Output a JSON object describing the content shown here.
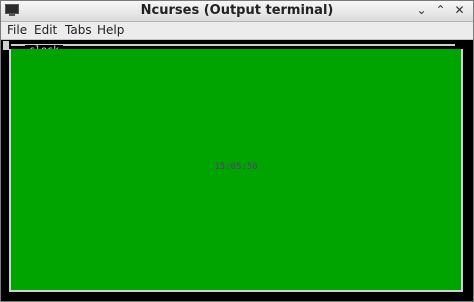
{
  "window": {
    "title": "Ncurses (Output terminal)",
    "controls": {
      "minimize": "⌄",
      "maximize": "⌃",
      "close": "✕"
    }
  },
  "menu": {
    "items": [
      "File",
      "Edit",
      "Tabs",
      "Help"
    ]
  },
  "terminal": {
    "frame_label": "clock",
    "time": "15:05:56",
    "colors": {
      "background": "#000000",
      "panel": "#00a400",
      "frame": "#d0d0d0",
      "time_text": "#5a3a7a"
    }
  }
}
